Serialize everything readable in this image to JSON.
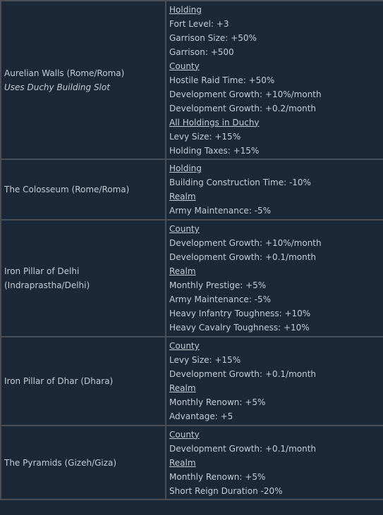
{
  "rows": [
    {
      "name": "Aurelian Walls (Rome/Roma)",
      "note": "Uses Duchy Building Slot",
      "effects": [
        {
          "text": "Holding",
          "heading": true
        },
        {
          "text": "Fort Level: +3",
          "heading": false
        },
        {
          "text": "Garrison Size: +50%",
          "heading": false
        },
        {
          "text": "Garrison: +500",
          "heading": false
        },
        {
          "text": "County",
          "heading": true
        },
        {
          "text": "Hostile Raid Time: +50%",
          "heading": false
        },
        {
          "text": "Development Growth: +10%/month",
          "heading": false
        },
        {
          "text": "Development Growth: +0.2/month",
          "heading": false
        },
        {
          "text": "All Holdings in Duchy",
          "heading": true
        },
        {
          "text": "Levy Size: +15%",
          "heading": false
        },
        {
          "text": "Holding Taxes: +15%",
          "heading": false
        }
      ]
    },
    {
      "name": "The Colosseum (Rome/Roma)",
      "note": null,
      "effects": [
        {
          "text": "Holding",
          "heading": true
        },
        {
          "text": "Building Construction Time: -10%",
          "heading": false
        },
        {
          "text": "Realm",
          "heading": true
        },
        {
          "text": "Army Maintenance: -5%",
          "heading": false
        }
      ]
    },
    {
      "name": "Iron Pillar of Delhi (Indraprastha/Delhi)",
      "note": null,
      "effects": [
        {
          "text": "County",
          "heading": true
        },
        {
          "text": "Development Growth: +10%/month",
          "heading": false
        },
        {
          "text": "Development Growth: +0.1/month",
          "heading": false
        },
        {
          "text": "Realm",
          "heading": true
        },
        {
          "text": "Monthly Prestige: +5%",
          "heading": false
        },
        {
          "text": "Army Maintenance: -5%",
          "heading": false
        },
        {
          "text": "Heavy Infantry Toughness: +10%",
          "heading": false
        },
        {
          "text": "Heavy Cavalry Toughness: +10%",
          "heading": false
        }
      ]
    },
    {
      "name": "Iron Pillar of Dhar (Dhara)",
      "note": null,
      "effects": [
        {
          "text": "County",
          "heading": true
        },
        {
          "text": "Levy Size: +15%",
          "heading": false
        },
        {
          "text": "Development Growth: +0.1/month",
          "heading": false
        },
        {
          "text": "Realm",
          "heading": true
        },
        {
          "text": "Monthly Renown: +5%",
          "heading": false
        },
        {
          "text": "Advantage: +5",
          "heading": false
        }
      ]
    },
    {
      "name": "The Pyramids (Gizeh/Giza)",
      "note": null,
      "effects": [
        {
          "text": "County",
          "heading": true
        },
        {
          "text": "Development Growth: +0.1/month",
          "heading": false
        },
        {
          "text": "Realm",
          "heading": true
        },
        {
          "text": "Monthly Renown: +5%",
          "heading": false
        },
        {
          "text": "Short Reign Duration -20%",
          "heading": false
        }
      ]
    }
  ],
  "colors": {
    "background": "#1b2838",
    "border": "#4b4f55",
    "text": "#c6ccd3"
  }
}
